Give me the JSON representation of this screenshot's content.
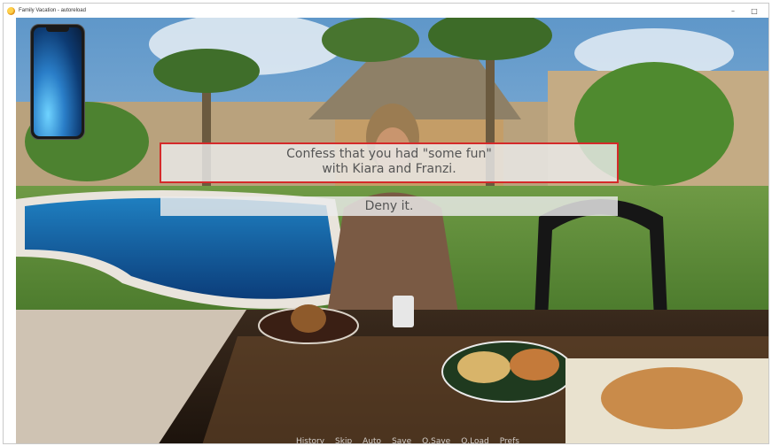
{
  "window": {
    "title": "Family Vacation - autoreload",
    "controls": {
      "minimize": "–",
      "maximize": "□"
    }
  },
  "dialogue": {
    "choices": [
      "Confess that you had \"some fun\" with Kiara and Franzi.",
      "Deny it."
    ]
  },
  "quick_menu": [
    "History",
    "Skip",
    "Auto",
    "Save",
    "Q.Save",
    "Q.Load",
    "Prefs"
  ],
  "colors": {
    "highlight": "#d42a2a",
    "choice_bg": "#ebebeb"
  }
}
